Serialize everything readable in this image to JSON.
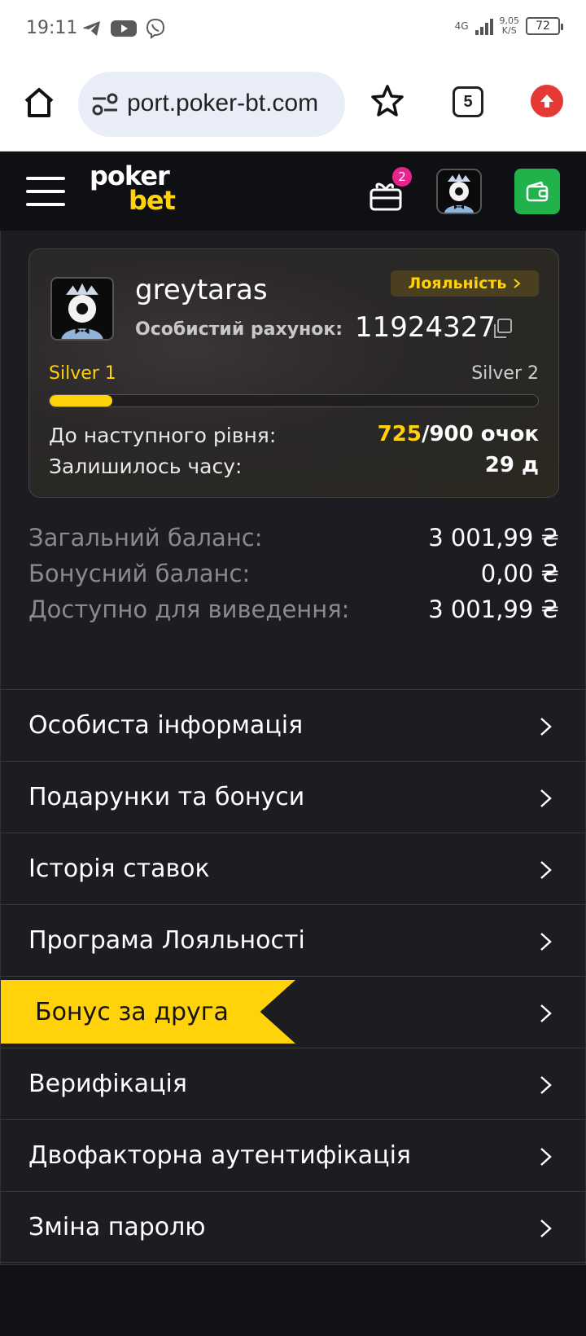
{
  "statusbar": {
    "time": "19:11",
    "network": "4G",
    "speed_value": "9,05",
    "speed_unit": "K/S",
    "battery": "72",
    "app_icons": [
      "telegram-icon",
      "youtube-icon",
      "viber-icon"
    ]
  },
  "browser": {
    "url": "port.poker-bt.com",
    "tab_count": "5"
  },
  "header": {
    "logo_line1": "poker",
    "logo_line2": "bet",
    "gift_badge": "2"
  },
  "profile": {
    "username": "greytaras",
    "loyalty_label": "Лояльність",
    "account_label": "Особистий рахунок:",
    "account_number": "11924327",
    "level_current": "Silver 1",
    "level_next": "Silver 2",
    "progress_fraction": 0.128,
    "next_level_label": "До наступного рівня:",
    "points_current": "725",
    "points_rest": "/900 очок",
    "time_left_label": "Залишилось часу:",
    "time_left_value": "29 д"
  },
  "balances": [
    {
      "label": "Загальний баланс:",
      "value": "3 001,99 ₴"
    },
    {
      "label": "Бонусний баланс:",
      "value": "0,00 ₴"
    },
    {
      "label": "Доступно для виведення:",
      "value": "3 001,99 ₴"
    }
  ],
  "menu": [
    {
      "label": "Особиста інформація"
    },
    {
      "label": "Подарунки та бонуси"
    },
    {
      "label": "Історія ставок"
    },
    {
      "label": "Програма Лояльності"
    },
    {
      "label": "Бонус за друга"
    },
    {
      "label": "Верифікація"
    },
    {
      "label": "Двофакторна аутентифікація"
    },
    {
      "label": "Зміна паролю"
    }
  ],
  "colors": {
    "accent": "#ffd20a",
    "wallet_green": "#22b24c",
    "badge_pink": "#e8238d",
    "background": "#1c1d21"
  }
}
